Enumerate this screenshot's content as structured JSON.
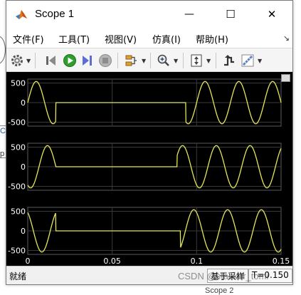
{
  "window": {
    "title": "Scope 1",
    "minimize_glyph": "—",
    "maximize_glyph": "☐",
    "close_glyph": "✕"
  },
  "menu": {
    "items": [
      "文件(F)",
      "工具(T)",
      "视图(V)",
      "仿真(I)",
      "帮助(H)"
    ],
    "pin_glyph": "↘"
  },
  "toolbar": {
    "icons": [
      "settings-icon",
      "restore-icon",
      "run-icon",
      "step-forward-icon",
      "stop-icon",
      "highlight-block-icon",
      "zoom-icon",
      "autoscale-icon",
      "triggers-icon",
      "measurements-icon"
    ]
  },
  "colors": {
    "signal": "#e6e65a",
    "grid": "#3a3a3a",
    "axes_bg": "#000000",
    "axes_text": "#ffffff"
  },
  "status": {
    "left": "就绪",
    "mode": "基于采样",
    "time": "T=0.150"
  },
  "backdrop": {
    "watermark": "CSDN @stacker_tomi",
    "bottom_label": "Scope 2",
    "side_text_1": "Co",
    "side_text_2": "p"
  },
  "chart_data": {
    "type": "line",
    "xlim": [
      0,
      0.15
    ],
    "xticks": [
      0,
      0.05,
      0.1,
      0.15
    ],
    "xtick_labels": [
      "0",
      "0.05",
      "0.1",
      "0.15"
    ],
    "grid": true,
    "legend": "none",
    "panels": [
      {
        "ylim": [
          -600,
          600
        ],
        "yticks": [
          500,
          0,
          -500
        ],
        "ytick_labels": [
          "500",
          "0",
          "-500"
        ],
        "amplitude": 540,
        "frequency_hz": 50,
        "phase": "sine",
        "segments": [
          [
            0,
            0.0165
          ],
          [
            0.0935,
            0.15
          ]
        ],
        "zero_between": [
          0.0165,
          0.0935
        ]
      },
      {
        "ylim": [
          -600,
          600
        ],
        "yticks": [
          500,
          0,
          -500
        ],
        "ytick_labels": [
          "500",
          "0",
          "-500"
        ],
        "amplitude": 540,
        "frequency_hz": 50,
        "phase": "sine-120",
        "segments": [
          [
            0,
            0.0165
          ],
          [
            0.0885,
            0.15
          ]
        ],
        "step_at": 0.0165,
        "zero_between": [
          0.0165,
          0.0885
        ]
      },
      {
        "ylim": [
          -600,
          600
        ],
        "yticks": [
          500,
          0,
          -500
        ],
        "ytick_labels": [
          "500",
          "0",
          "-500"
        ],
        "amplitude": 540,
        "frequency_hz": 50,
        "phase": "sine+120",
        "segments": [
          [
            0,
            0.0165
          ],
          [
            0.0905,
            0.15
          ]
        ],
        "zero_between": [
          0.0165,
          0.0905
        ]
      }
    ]
  }
}
